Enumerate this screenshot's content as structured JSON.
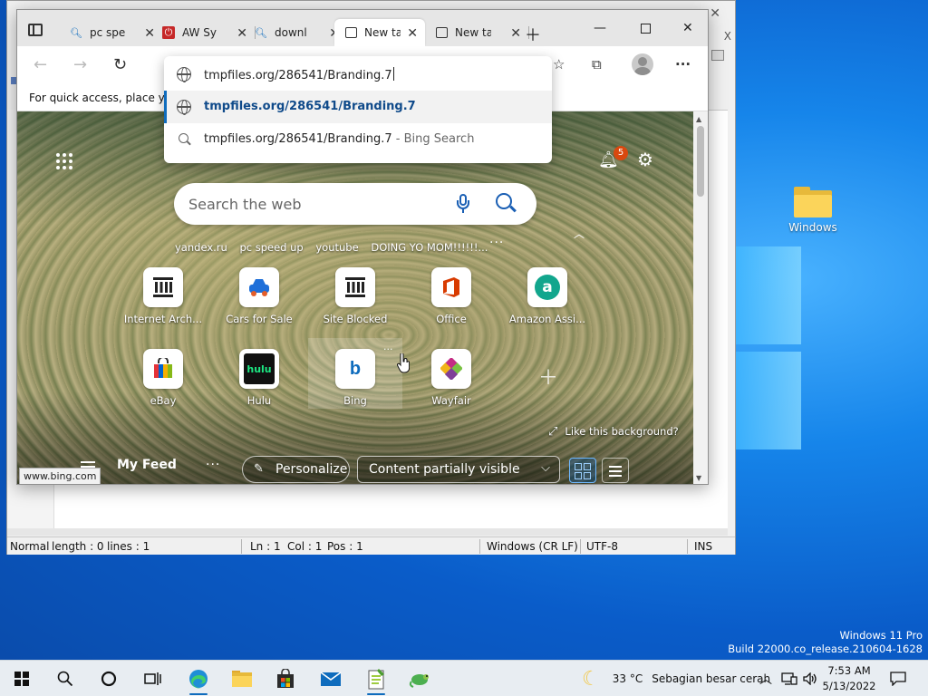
{
  "desktop": {
    "icon_label": "Windows",
    "watermark_line1": "Windows 11 Pro",
    "watermark_line2": "Build 22000.co_release.210604-1628"
  },
  "editor": {
    "status": {
      "mode": "Normal",
      "length": "length : 0",
      "lines": "lines : 1",
      "ln": "Ln : 1",
      "col": "Col : 1",
      "pos": "Pos : 1",
      "eol": "Windows (CR LF)",
      "encoding": "UTF-8",
      "ins": "INS"
    }
  },
  "browser": {
    "tabs": [
      {
        "label": "pc spe",
        "icon": "search-icon"
      },
      {
        "label": "AW Sy",
        "icon": "power-icon"
      },
      {
        "label": "downl",
        "icon": "search-icon"
      },
      {
        "label": "New ta",
        "icon": "newtab-icon",
        "active": true
      },
      {
        "label": "New ta",
        "icon": "newtab-icon"
      }
    ],
    "favorites_hint": "For quick access, place y",
    "omnibox": {
      "typed": "tmpfiles.org/286541/Branding.7",
      "suggestion_url": "tmpfiles.org/286541/Branding.7",
      "suggestion_search": "tmpfiles.org/286541/Branding.7",
      "suggestion_search_suffix": " - Bing Search"
    },
    "newtab": {
      "notification_count": "5",
      "search_placeholder": "Search the web",
      "quick_links": [
        "yandex.ru",
        "pc speed up",
        "youtube",
        "DOING YO MOM!!!!!!..."
      ],
      "tiles": [
        {
          "name": "Internet Arch...",
          "icon": "archive-icon"
        },
        {
          "name": "Cars for Sale",
          "icon": "car-icon"
        },
        {
          "name": "Site Blocked",
          "icon": "archive-icon"
        },
        {
          "name": "Office",
          "icon": "office-icon"
        },
        {
          "name": "Amazon Assi...",
          "icon": "amazon-icon"
        },
        {
          "name": "eBay",
          "icon": "ebay-icon"
        },
        {
          "name": "Hulu",
          "icon": "hulu-icon"
        },
        {
          "name": "Bing",
          "icon": "bing-icon"
        },
        {
          "name": "Wayfair",
          "icon": "wayfair-icon"
        }
      ],
      "like_background": "Like this background?",
      "my_feed": "My Feed",
      "personalize": "Personalize",
      "content_visibility": "Content partially visible",
      "status_url": "www.bing.com"
    }
  },
  "taskbar": {
    "weather_temp": "33 °C",
    "weather_desc": "Sebagian besar cerah",
    "time": "7:53 AM",
    "date": "5/13/2022"
  },
  "colors": {
    "accent": "#0f6cbd",
    "desktop_blue": "#1685ea",
    "badge": "#d9480f"
  }
}
